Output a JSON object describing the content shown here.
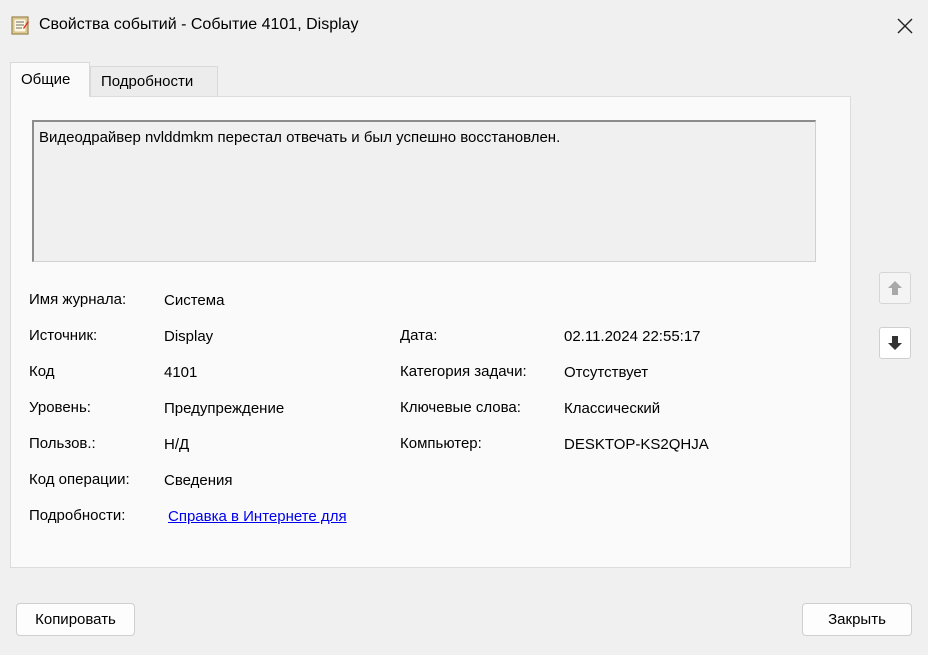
{
  "window": {
    "title": "Свойства событий - Событие 4101, Display"
  },
  "tabs": [
    {
      "label": "Общие",
      "active": true
    },
    {
      "label": "Подробности",
      "active": false
    }
  ],
  "event": {
    "description": "Видеодрайвер nvlddmkm перестал отвечать и был успешно восстановлен.",
    "fields_left": [
      {
        "label": "Имя журнала:",
        "value": "Система"
      },
      {
        "label": "Источник:",
        "value": "Display"
      },
      {
        "label": "Код",
        "value": "4101"
      },
      {
        "label": "Уровень:",
        "value": "Предупреждение"
      },
      {
        "label": "Пользов.:",
        "value": "Н/Д"
      },
      {
        "label": "Код операции:",
        "value": "Сведения"
      },
      {
        "label": "Подробности:",
        "value": "Справка в Интернете для "
      }
    ],
    "fields_right": [
      {
        "label": "Дата:",
        "value": "02.11.2024 22:55:17"
      },
      {
        "label": "Категория задачи:",
        "value": "Отсутствует"
      },
      {
        "label": "Ключевые слова:",
        "value": "Классический"
      },
      {
        "label": "Компьютер:",
        "value": "DESKTOP-KS2QHJA"
      }
    ]
  },
  "buttons": {
    "copy_label": "Копировать",
    "close_label": "Закрыть"
  },
  "colors": {
    "link": "#0000ee",
    "background": "#f0f0f0",
    "panel": "#fafafa"
  }
}
